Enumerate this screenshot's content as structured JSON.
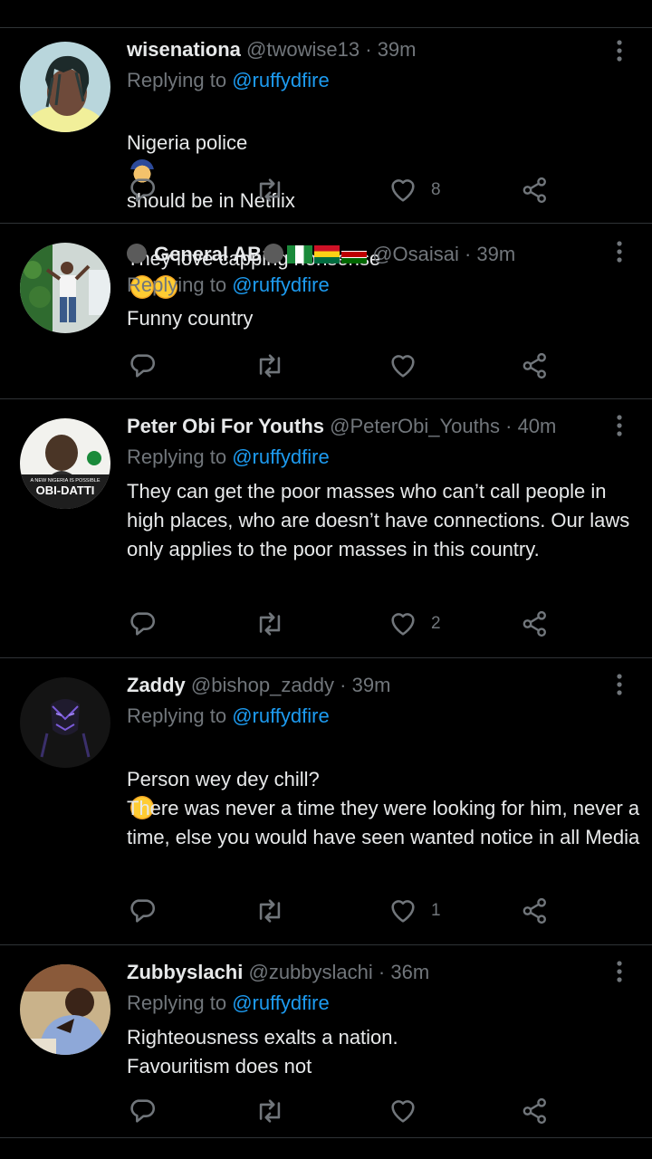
{
  "tweets": [
    {
      "name": "wisenationa",
      "handle": "@twowise13",
      "sep": "·",
      "time": "39m",
      "replying_prefix": "Replying to ",
      "replying_to": "@ruffydfire",
      "lines": [
        "Nigeria police",
        "should be in Netflix",
        "They love capping nonsense"
      ],
      "likes": "8"
    },
    {
      "name": "General AB",
      "handle": "@Osaisai",
      "sep": "·",
      "time": "39m",
      "replying_prefix": "Replying to ",
      "replying_to": "@ruffydfire",
      "text": "Funny country",
      "likes": ""
    },
    {
      "name": "Peter Obi For Youths",
      "handle": "@PeterObi_Youths",
      "sep": "·",
      "time": "40m",
      "replying_prefix": "Replying to ",
      "replying_to": "@ruffydfire",
      "text": "They can get the poor masses who can’t call people in high places, who are doesn’t have connections. Our laws only applies to the poor masses in this country.",
      "likes": "2",
      "avatar_text_top": "A NEW NIGERIA IS POSSIBLE",
      "avatar_text_bottom": "OBI-DATTI"
    },
    {
      "name": "Zaddy",
      "handle": "@bishop_zaddy",
      "sep": "·",
      "time": "39m",
      "replying_prefix": "Replying to ",
      "replying_to": "@ruffydfire",
      "line1": "Person wey dey chill?",
      "text2": "There was never a time they were looking for him, never a time, else you would have seen wanted notice in all Media",
      "likes": "1"
    },
    {
      "name": "Zubbyslachi",
      "handle": "@zubbyslachi",
      "sep": "·",
      "time": "36m",
      "replying_prefix": "Replying to ",
      "replying_to": "@ruffydfire",
      "text": "Righteousness exalts a nation.\nFavouritism does not",
      "likes": ""
    }
  ],
  "icons": {
    "reply": "reply-icon",
    "retweet": "retweet-icon",
    "like": "heart-icon",
    "share": "share-icon",
    "more": "more-icon"
  },
  "colors": {
    "background": "#000000",
    "text": "#e7e9ea",
    "secondary": "#71767b",
    "link": "#1d9bf0",
    "divider": "#2f3336"
  }
}
